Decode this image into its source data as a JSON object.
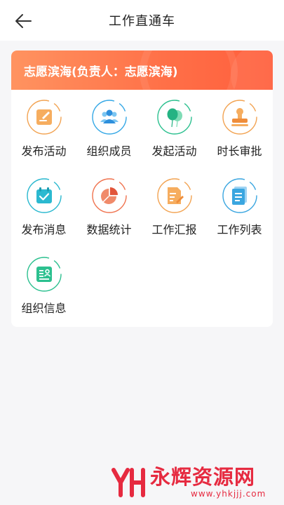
{
  "header": {
    "title": "工作直通车"
  },
  "org": {
    "name": "志愿滨海(负责人：志愿滨海)"
  },
  "items": [
    {
      "label": "发布活动",
      "icon": "publish-activity-icon",
      "color": "#f2a352"
    },
    {
      "label": "组织成员",
      "icon": "members-icon",
      "color": "#35a8e6"
    },
    {
      "label": "发起活动",
      "icon": "balloon-icon",
      "color": "#2cc08f"
    },
    {
      "label": "时长审批",
      "icon": "stamp-icon",
      "color": "#f2a352"
    },
    {
      "label": "发布消息",
      "icon": "calendar-check-icon",
      "color": "#29b8cf"
    },
    {
      "label": "数据统计",
      "icon": "pie-chart-icon",
      "color": "#f0734f"
    },
    {
      "label": "工作汇报",
      "icon": "report-icon",
      "color": "#f2a352"
    },
    {
      "label": "工作列表",
      "icon": "list-doc-icon",
      "color": "#3aa6e0"
    },
    {
      "label": "组织信息",
      "icon": "org-info-icon",
      "color": "#2cc08f"
    }
  ],
  "watermark": {
    "main": "永辉资源网",
    "sub": "www.yhkjjj.com"
  },
  "colors": {
    "banner_start": "#ff9360",
    "banner_end": "#ff5f3d",
    "watermark": "#e62a40"
  }
}
